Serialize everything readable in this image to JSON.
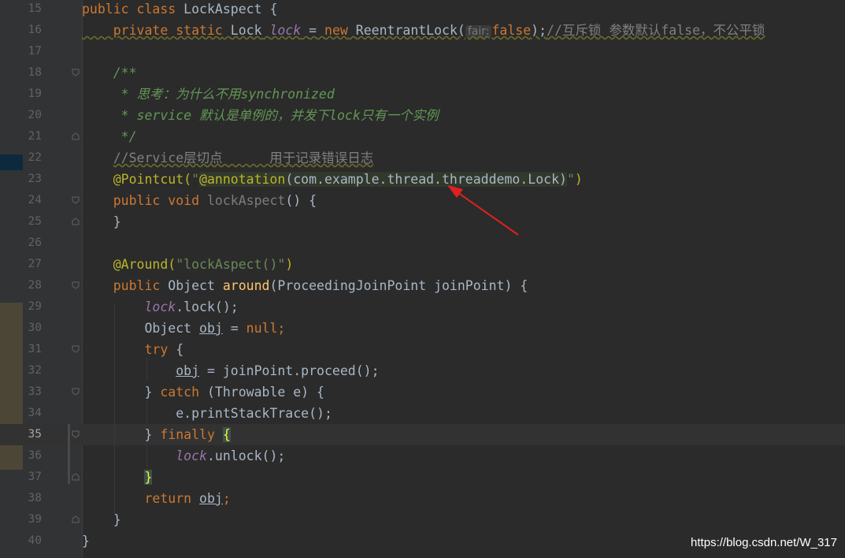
{
  "editor": {
    "lines": [
      {
        "n": "15"
      },
      {
        "n": "16"
      },
      {
        "n": "17"
      },
      {
        "n": "18"
      },
      {
        "n": "19"
      },
      {
        "n": "20"
      },
      {
        "n": "21"
      },
      {
        "n": "22"
      },
      {
        "n": "23"
      },
      {
        "n": "24"
      },
      {
        "n": "25"
      },
      {
        "n": "26"
      },
      {
        "n": "27"
      },
      {
        "n": "28"
      },
      {
        "n": "29"
      },
      {
        "n": "30"
      },
      {
        "n": "31"
      },
      {
        "n": "32"
      },
      {
        "n": "33"
      },
      {
        "n": "34"
      },
      {
        "n": "35"
      },
      {
        "n": "36"
      },
      {
        "n": "37"
      },
      {
        "n": "38"
      },
      {
        "n": "39"
      },
      {
        "n": "40"
      }
    ],
    "current_line": "35",
    "code": {
      "l15_public": "public",
      "l15_class": "class",
      "l15_name": "LockAspect",
      "l15_brace": "{",
      "l16_private": "private",
      "l16_static": "static",
      "l16_type": "Lock",
      "l16_field": "lock",
      "l16_eq": "=",
      "l16_new": "new",
      "l16_ctor": "ReentrantLock(",
      "l16_hint": "fair:",
      "l16_false": "false",
      "l16_end": ");",
      "l16_comment": "//互斥锁 参数默认false，不公平锁",
      "l18_doc": "/**",
      "l19_doc": " * 思考：为什么不用synchronized",
      "l20_doc": " * service 默认是单例的，并发下lock只有一个实例",
      "l21_doc": " */",
      "l22_comment": "//Service层切点      用于记录错误日志",
      "l23_ann": "@Pointcut(",
      "l23_q1": "\"",
      "l23_ann2": "@annotation",
      "l23_str": "(com.example.thread.threaddemo.Lock)",
      "l23_q2": "\"",
      "l23_end": ")",
      "l24_public": "public",
      "l24_void": "void",
      "l24_name": "lockAspect",
      "l24_parens": "()",
      "l24_brace": "{",
      "l25_brace": "}",
      "l27_ann": "@Around(",
      "l27_str": "\"lockAspect()\"",
      "l27_end": ")",
      "l28_public": "public",
      "l28_type": "Object",
      "l28_name": "around",
      "l28_params": "(ProceedingJoinPoint joinPoint)",
      "l28_brace": "{",
      "l29_field": "lock",
      "l29_call": ".lock();",
      "l30_type": "Object",
      "l30_var": "obj",
      "l30_eq": "=",
      "l30_null": "null",
      "l30_semi": ";",
      "l31_try": "try",
      "l31_brace": "{",
      "l32_var": "obj",
      "l32_rest": " = joinPoint.proceed();",
      "l33_close": "}",
      "l33_catch": "catch",
      "l33_params": "(Throwable e)",
      "l33_brace": "{",
      "l34_call": "e.printStackTrace();",
      "l35_close": "}",
      "l35_finally": "finally",
      "l35_brace": "{",
      "l36_field": "lock",
      "l36_call": ".unlock();",
      "l37_brace": "}",
      "l38_return": "return",
      "l38_var": "obj",
      "l38_semi": ";",
      "l39_brace": "}",
      "l40_brace": "}"
    }
  },
  "watermark": "https://blog.csdn.net/W_317",
  "colors": {
    "background": "#2b2b2b",
    "gutter": "#313335",
    "keyword": "#cc7832",
    "string": "#6a8759",
    "annotation": "#bbb529",
    "comment": "#808080",
    "doc_comment": "#629755",
    "static_field": "#9876aa",
    "method": "#ffc66d",
    "arrow": "#e02020"
  },
  "icons": [
    "fold-marker-icon",
    "red-arrow-annotation"
  ]
}
